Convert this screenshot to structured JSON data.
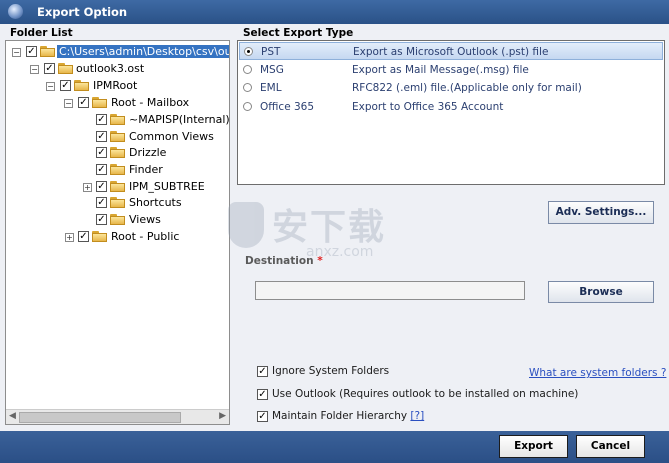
{
  "window": {
    "title": "Export Option"
  },
  "folder_panel": {
    "heading": "Folder List",
    "tree": [
      {
        "label": "C:\\Users\\admin\\Desktop\\csv\\outlo",
        "expander": "-",
        "selected": true
      },
      {
        "label": "outlook3.ost",
        "expander": "-"
      },
      {
        "label": "IPMRoot",
        "expander": "-"
      },
      {
        "label": "Root - Mailbox",
        "expander": "-"
      },
      {
        "label": "~MAPISP(Internal)",
        "expander": ""
      },
      {
        "label": "Common Views",
        "expander": ""
      },
      {
        "label": "Drizzle",
        "expander": ""
      },
      {
        "label": "Finder",
        "expander": ""
      },
      {
        "label": "IPM_SUBTREE",
        "expander": "+"
      },
      {
        "label": "Shortcuts",
        "expander": ""
      },
      {
        "label": "Views",
        "expander": ""
      },
      {
        "label": "Root - Public",
        "expander": "+"
      }
    ]
  },
  "export_panel": {
    "heading": "Select Export Type",
    "types": [
      {
        "type": "PST",
        "desc": "Export as Microsoft Outlook (.pst) file",
        "selected": true
      },
      {
        "type": "MSG",
        "desc": "Export as Mail Message(.msg) file",
        "selected": false
      },
      {
        "type": "EML",
        "desc": "RFC822 (.eml) file.(Applicable only for mail)",
        "selected": false
      },
      {
        "type": "Office 365",
        "desc": "Export to Office 365 Account",
        "selected": false
      }
    ],
    "adv_settings_label": "Adv. Settings..."
  },
  "destination": {
    "label": "Destination",
    "required_mark": "*",
    "value": "",
    "browse_label": "Browse"
  },
  "watermark": {
    "cn": "安下载",
    "en": "anxz.com"
  },
  "options": {
    "ignore_system": {
      "label": "Ignore System Folders",
      "checked": true
    },
    "system_link": "What are system folders ?",
    "use_outlook": {
      "label": "Use Outlook (Requires outlook to be installed on machine)",
      "checked": true
    },
    "maintain_hierarchy": {
      "label": "Maintain Folder Hierarchy",
      "link": "[?]",
      "checked": true
    }
  },
  "footer": {
    "export_label": "Export",
    "cancel_label": "Cancel"
  }
}
